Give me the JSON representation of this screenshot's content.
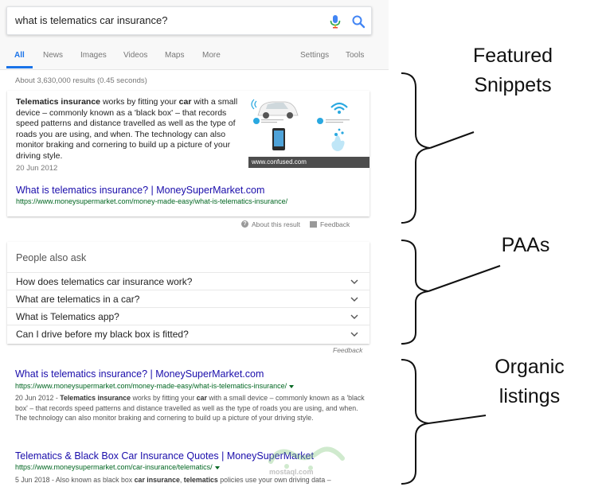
{
  "search": {
    "query": "what is telematics car insurance?"
  },
  "tabs": {
    "all": "All",
    "news": "News",
    "images": "Images",
    "videos": "Videos",
    "maps": "Maps",
    "more": "More",
    "settings": "Settings",
    "tools": "Tools"
  },
  "stats": "About 3,630,000 results (0.45 seconds)",
  "featured": {
    "text_bold_1": "Telematics insurance",
    "text_part_1": " works by fitting your ",
    "text_bold_2": "car",
    "text_part_2": " with a small device – commonly known as a 'black box' – that records speed patterns and distance travelled as well as the type of roads you are using, and when. The technology can also monitor braking and cornering to build up a picture of your driving style.",
    "date": "20 Jun 2012",
    "image_caption": "www.confused.com",
    "link": "What is telematics insurance? | MoneySuperMarket.com",
    "url": "https://www.moneysupermarket.com/money-made-easy/what-is-telematics-insurance/",
    "about": "About this result",
    "feedback": "Feedback"
  },
  "paa": {
    "title": "People also ask",
    "questions": [
      "How does telematics car insurance work?",
      "What are telematics in a car?",
      "What is Telematics app?",
      "Can I drive before my black box is fitted?"
    ],
    "feedback": "Feedback"
  },
  "organic": [
    {
      "title": "What is telematics insurance? | MoneySuperMarket.com",
      "url": "https://www.moneysupermarket.com/money-made-easy/what-is-telematics-insurance/",
      "date": "20 Jun 2012 - ",
      "bold_1": "Telematics insurance",
      "part_1": " works by fitting your ",
      "bold_2": "car",
      "part_2": " with a small device – commonly known as a 'black box' – that records speed patterns and distance travelled as well as the type of roads you are using, and when. The technology can also monitor braking and cornering to build up a picture of your driving style."
    },
    {
      "title": "Telematics & Black Box Car Insurance Quotes | MoneySuperMarket",
      "url": "https://www.moneysupermarket.com/car-insurance/telematics/",
      "date": "5 Jun 2018 - ",
      "part_1": "Also known as black box ",
      "bold_1": "car insurance",
      "part_2": ", ",
      "bold_2": "telematics",
      "part_3": " policies use your own driving data –"
    }
  ],
  "watermark": "mostaql.com",
  "annotations": {
    "featured_line_1": "Featured",
    "featured_line_2": "Snippets",
    "paa": "PAAs",
    "organic_line_1": "Organic",
    "organic_line_2": "listings"
  }
}
